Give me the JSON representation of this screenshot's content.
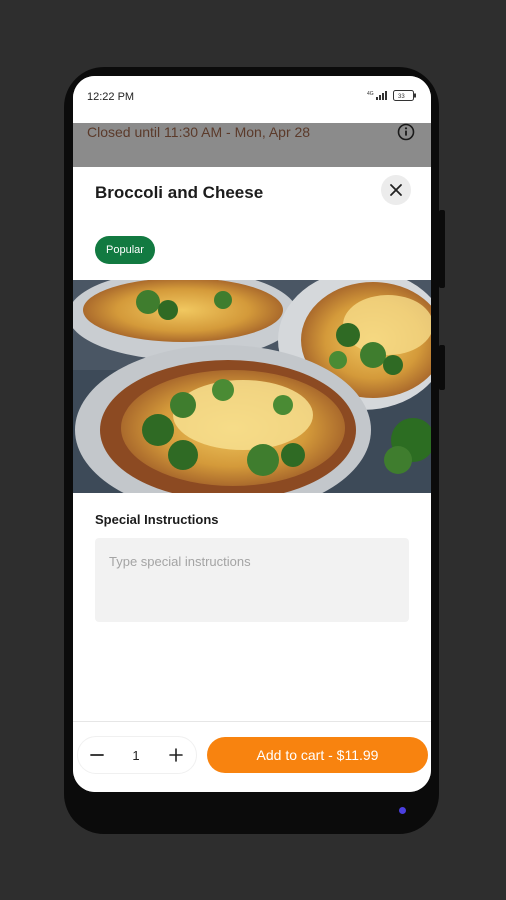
{
  "status_bar": {
    "time": "12:22 PM",
    "battery_label": "33"
  },
  "banner": {
    "closed_text": "Closed until 11:30 AM - Mon, Apr 28"
  },
  "item": {
    "title": "Broccoli and Cheese",
    "badge": "Popular"
  },
  "instructions": {
    "label": "Special Instructions",
    "placeholder": "Type special instructions",
    "value": ""
  },
  "cart": {
    "quantity": "1",
    "add_label": "Add to cart - $11.99"
  },
  "colors": {
    "badge_green": "#127a41",
    "cta_orange": "#f8830f",
    "banner_gray": "#8b8b8b"
  }
}
